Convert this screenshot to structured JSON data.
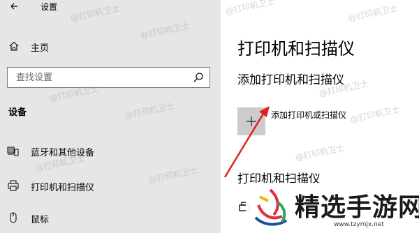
{
  "window": {
    "title": "设置"
  },
  "sidebar": {
    "home_label": "主页",
    "search": {
      "placeholder": "查找设置"
    },
    "section_heading": "设备",
    "items": [
      {
        "label": "蓝牙和其他设备",
        "icon": "bluetooth-devices-icon"
      },
      {
        "label": "打印机和扫描仪",
        "icon": "printer-icon"
      },
      {
        "label": "鼠标",
        "icon": "mouse-icon"
      }
    ]
  },
  "main": {
    "page_title": "打印机和扫描仪",
    "add_section_heading": "添加打印机和扫描仪",
    "add_button_label": "添加打印机或扫描仪",
    "list_heading": "打印机和扫描仪"
  },
  "watermark": {
    "text": "@打印机卫士"
  },
  "logo": {
    "brand": "精选手游网",
    "url": "www.tzymjx.net"
  },
  "colors": {
    "sidebar_bg": "#e6e6e6",
    "add_button_bg": "#cccccc",
    "arrow": "#e02020"
  }
}
